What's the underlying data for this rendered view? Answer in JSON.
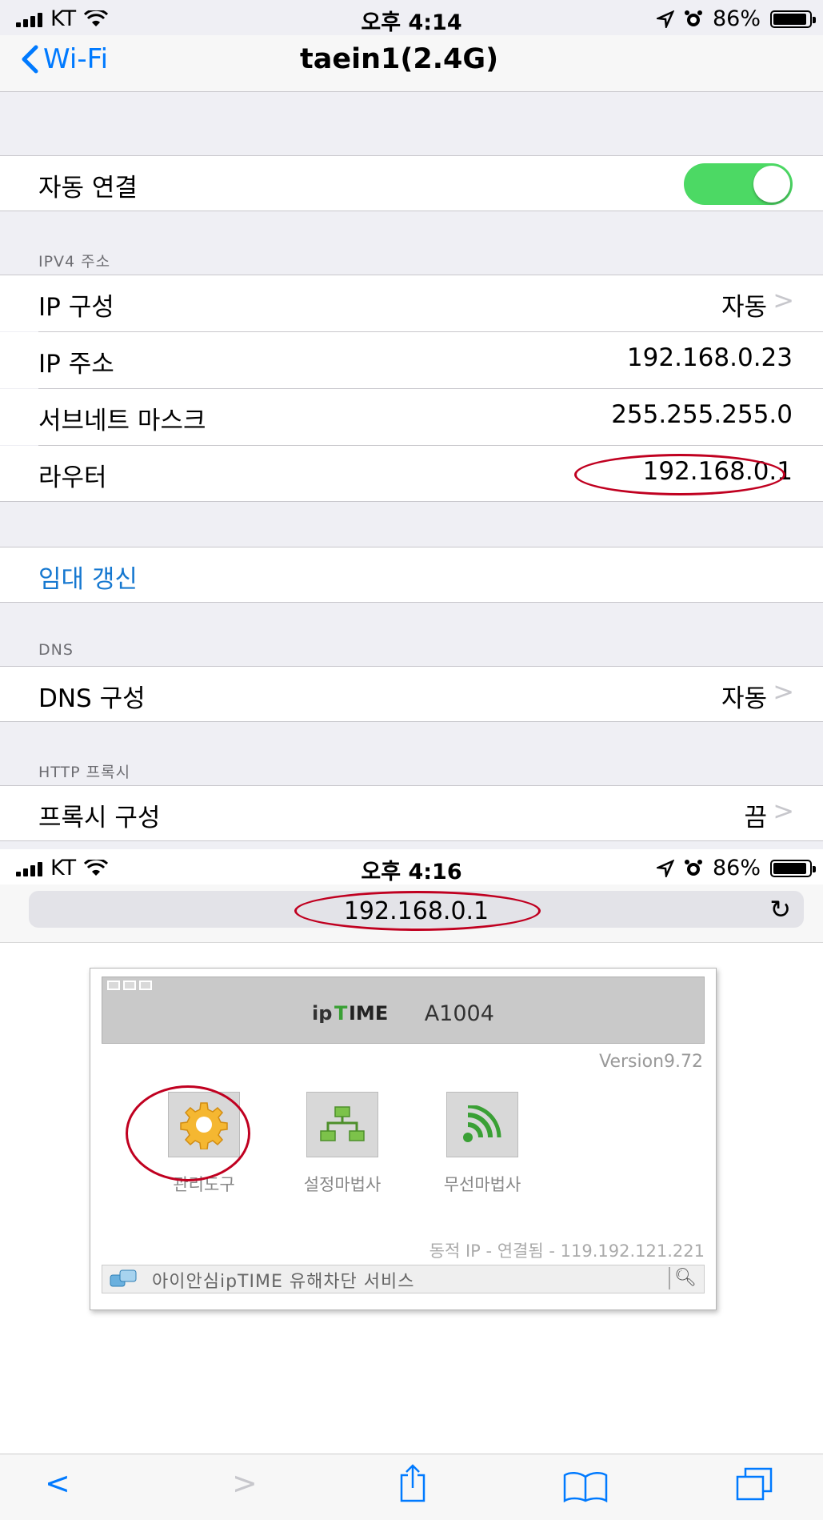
{
  "settings_screen": {
    "status_bar": {
      "carrier": "KT",
      "time": "오후 4:14",
      "battery": "86%",
      "battery_level": 0.86
    },
    "nav": {
      "back_label": "Wi-Fi",
      "title": "taein1(2.4G)"
    },
    "auto_join": {
      "label": "자동 연결",
      "enabled": true
    },
    "ipv4": {
      "header": "IPV4 주소",
      "rows": [
        {
          "label": "IP 구성",
          "value": "자동"
        },
        {
          "label": "IP 주소",
          "value": "192.168.0.23"
        },
        {
          "label": "서브네트 마스크",
          "value": "255.255.255.0"
        },
        {
          "label": "라우터",
          "value": "192.168.0.1"
        }
      ]
    },
    "renew_lease": "임대 갱신",
    "dns": {
      "header": "DNS",
      "label": "DNS 구성",
      "value": "자동"
    },
    "proxy": {
      "header": "HTTP 프록시",
      "label": "프록시 구성",
      "value": "끔"
    }
  },
  "browser_screen": {
    "status_bar": {
      "carrier": "KT",
      "time": "오후 4:16",
      "battery": "86%",
      "battery_level": 0.86
    },
    "url": "192.168.0.1",
    "router_page": {
      "model": "A1004",
      "version": "Version9.72",
      "tools": [
        {
          "label": "관리도구",
          "icon": "gear-icon"
        },
        {
          "label": "설정마법사",
          "icon": "network-icon"
        },
        {
          "label": "무선마법사",
          "icon": "wireless-icon"
        }
      ],
      "status": "동적 IP - 연결됨 - 119.192.121.221",
      "service_bar": "아이안심ipTIME 유해차단 서비스"
    },
    "toolbar": [
      "back-icon",
      "forward-icon",
      "share-icon",
      "bookmarks-icon",
      "tabs-icon"
    ]
  },
  "colors": {
    "ios_blue": "#007aff",
    "toggle_green": "#4cd964",
    "annotation_red": "#c00020"
  }
}
